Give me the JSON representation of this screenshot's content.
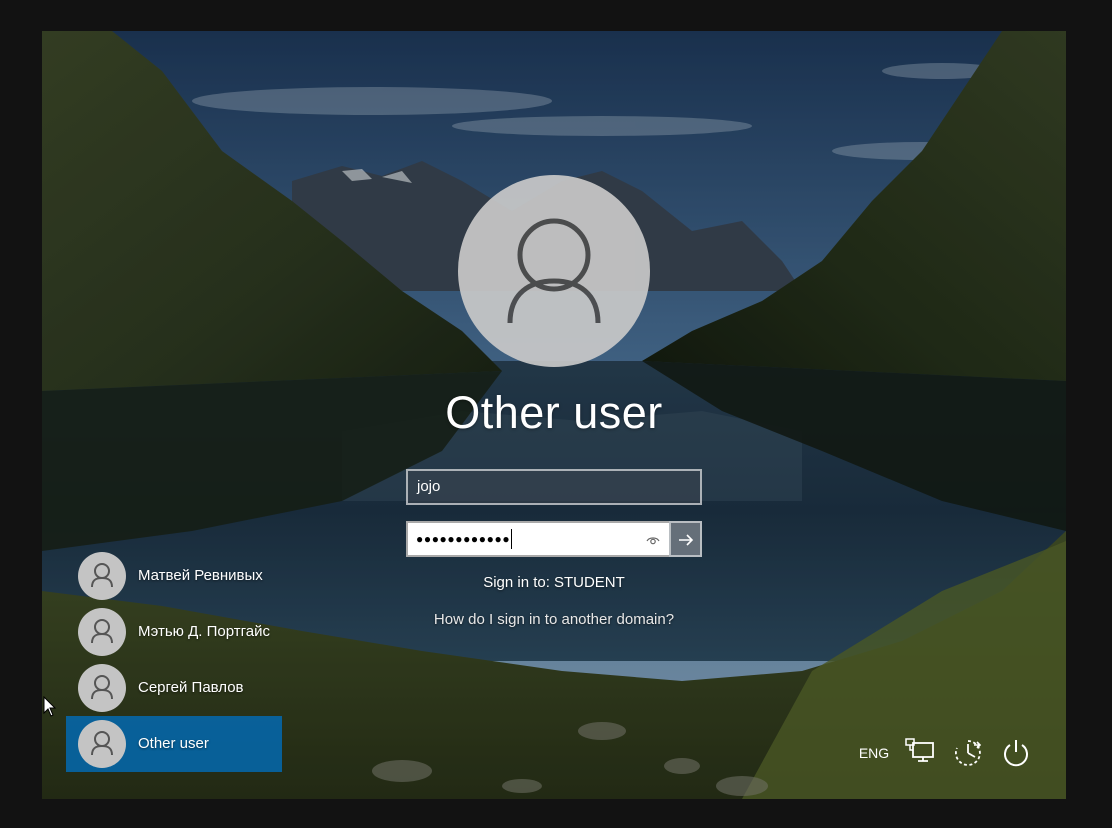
{
  "login": {
    "display_user": "Other user",
    "username_value": "jojo",
    "password_dots": "●●●●●●●●●●●●",
    "signin_prefix": "Sign in to:",
    "signin_domain": "STUDENT",
    "help_link": "How do I sign in to another domain?"
  },
  "users": [
    {
      "name": "Матвей Ревнивых",
      "selected": false
    },
    {
      "name": "Мэтью Д. Портгайс",
      "selected": false
    },
    {
      "name": "Сергей Павлов",
      "selected": false
    },
    {
      "name": "Other user",
      "selected": true
    }
  ],
  "tray": {
    "language": "ENG",
    "network_icon": "network-icon",
    "ease_of_access_icon": "ease-of-access-icon",
    "power_icon": "power-icon"
  },
  "colors": {
    "selection": "#0a6ebe",
    "avatar_bg": "#c9c9c9",
    "avatar_fg": "#525252"
  }
}
